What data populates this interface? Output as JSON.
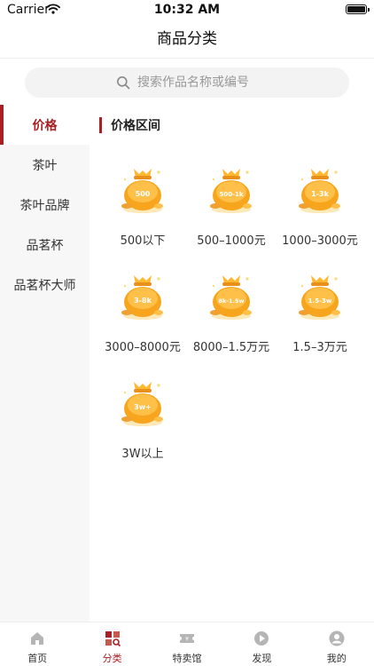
{
  "status_bar": {
    "carrier": "Carrier",
    "time": "10:32 AM"
  },
  "nav": {
    "title": "商品分类"
  },
  "search": {
    "placeholder": "搜索作品名称或编号"
  },
  "sidebar": {
    "items": [
      {
        "label": "价格",
        "active": true
      },
      {
        "label": "茶叶"
      },
      {
        "label": "茶叶品牌"
      },
      {
        "label": "品茗杯"
      },
      {
        "label": "品茗杯大师"
      }
    ]
  },
  "section": {
    "title": "价格区间"
  },
  "price_ranges": [
    {
      "badge": "500",
      "label": "500以下"
    },
    {
      "badge": "500-1k",
      "label": "500–1000元"
    },
    {
      "badge": "1-3k",
      "label": "1000–3000元"
    },
    {
      "badge": "3-8k",
      "label": "3000–8000元"
    },
    {
      "badge": "8k-1.5w",
      "label": "8000–1.5万元"
    },
    {
      "badge": "1.5-3w",
      "label": "1.5–3万元"
    },
    {
      "badge": "3w+",
      "label": "3W以上"
    }
  ],
  "tab_bar": {
    "tabs": [
      {
        "label": "首页",
        "icon": "home-icon"
      },
      {
        "label": "分类",
        "icon": "category-icon",
        "active": true
      },
      {
        "label": "特卖馆",
        "icon": "ticket-icon"
      },
      {
        "label": "发现",
        "icon": "play-icon"
      },
      {
        "label": "我的",
        "icon": "user-icon"
      }
    ]
  },
  "colors": {
    "accent": "#a82025",
    "bag": "#f7a51c",
    "sidebar_bg": "#f7f7f7"
  }
}
